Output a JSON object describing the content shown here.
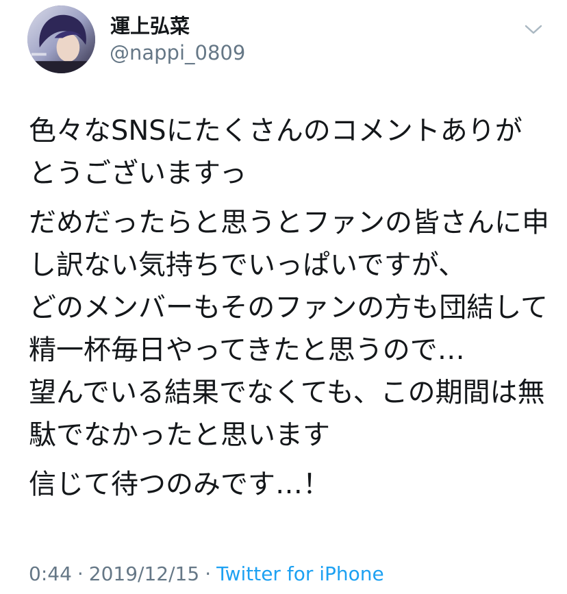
{
  "tweet": {
    "author": {
      "display_name": "運上弘菜",
      "username": "@nappi_0809"
    },
    "menu_icon": "chevron-down-icon",
    "paragraphs": [
      "色々なSNSにたくさんのコメントありがとうございますっ",
      "だめだったらと思うとファンの皆さんに申し訳ない気持ちでいっぱいですが、\nどのメンバーもそのファンの方も団結して精一杯毎日やってきたと思うので…\n望んでいる結果でなくても、この期間は無駄でなかったと思います",
      "信じて待つのみです…！"
    ],
    "time": "0:44",
    "separator": "·",
    "date": "2019/12/15",
    "source": "Twitter for iPhone"
  },
  "colors": {
    "text": "#14171a",
    "secondary": "#657786",
    "link": "#1da1f2"
  }
}
